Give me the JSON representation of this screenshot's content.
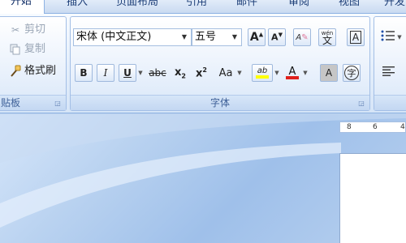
{
  "tabs": [
    {
      "label": "开始",
      "active": true
    },
    {
      "label": "插入"
    },
    {
      "label": "页面布局"
    },
    {
      "label": "引用"
    },
    {
      "label": "邮件"
    },
    {
      "label": "审阅"
    },
    {
      "label": "视图"
    },
    {
      "label": "开发"
    }
  ],
  "clipboard": {
    "cut": "剪切",
    "copy": "复制",
    "format_painter": "格式刷",
    "group_label": "贴板"
  },
  "font": {
    "font_name": "宋体 (中文正文)",
    "font_size": "五号",
    "group_label": "字体",
    "grow_glyph": "A",
    "shrink_glyph": "A",
    "clear_glyph": "A",
    "phonetic_glyph": "wén",
    "phonetic_char": "文",
    "border_glyph": "A",
    "bold": "B",
    "italic": "I",
    "underline": "U",
    "strike": "abc",
    "subscript": "x",
    "sub_mark": "2",
    "superscript": "x",
    "sup_mark": "2",
    "change_case": "Aa",
    "highlight": "ab",
    "font_color_glyph": "A",
    "shading_glyph": "A",
    "enclose_char": "字",
    "font_color": "#e0201c",
    "highlight_color": "#ffff00"
  },
  "ruler": {
    "labels": [
      "8",
      "6",
      "4"
    ]
  }
}
